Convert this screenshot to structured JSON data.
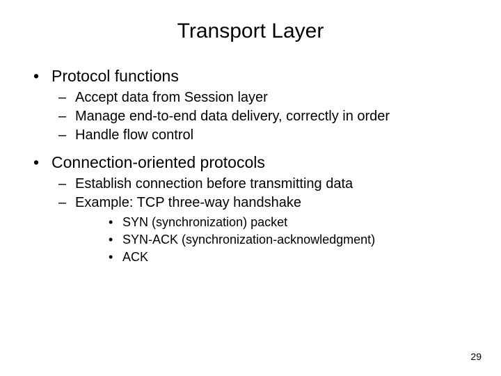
{
  "title": "Transport Layer",
  "page_number": "29",
  "bullets": [
    {
      "text": "Protocol functions",
      "children": [
        {
          "text": "Accept data from Session layer"
        },
        {
          "text": "Manage end-to-end data delivery, correctly in order"
        },
        {
          "text": "Handle flow control"
        }
      ]
    },
    {
      "text": "Connection-oriented protocols",
      "children": [
        {
          "text": "Establish connection before transmitting data"
        },
        {
          "text": "Example: TCP three-way handshake",
          "children": [
            {
              "text": "SYN (synchronization) packet"
            },
            {
              "text": "SYN-ACK (synchronization-acknowledgment)"
            },
            {
              "text": "ACK"
            }
          ]
        }
      ]
    }
  ]
}
